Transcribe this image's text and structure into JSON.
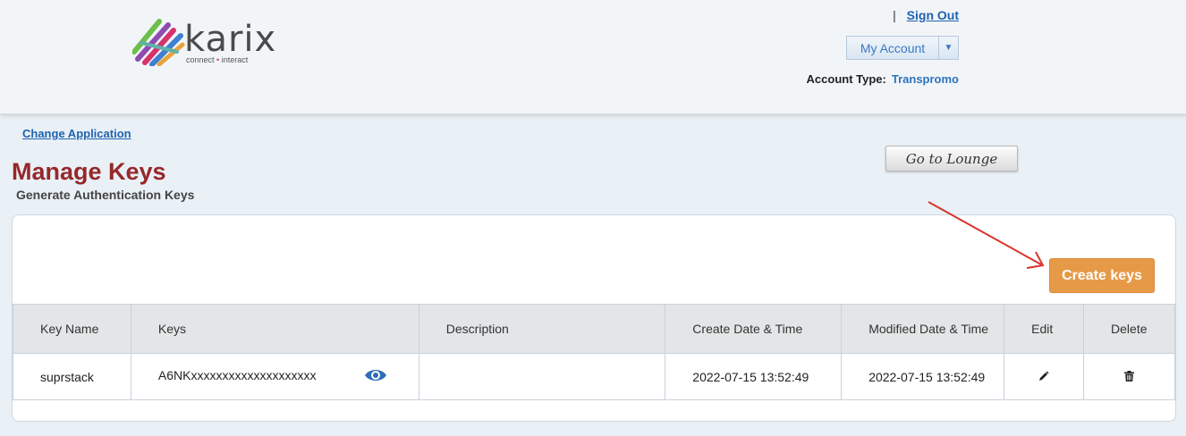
{
  "header": {
    "logo": {
      "brand": "karix",
      "tagline_left": "connect",
      "tagline_right": "interact",
      "tagline_separator": "•"
    },
    "separator": "|",
    "sign_out": "Sign Out",
    "my_account": "My Account",
    "account_type_label": "Account Type:",
    "account_type_value": "Transpromo"
  },
  "nav": {
    "change_application": "Change Application"
  },
  "page": {
    "title": "Manage Keys",
    "subtitle": "Generate Authentication Keys",
    "go_to_lounge": "Go to Lounge",
    "create_keys": "Create keys"
  },
  "table": {
    "headers": [
      "Key Name",
      "Keys",
      "Description",
      "Create Date & Time",
      "Modified Date & Time",
      "Edit",
      "Delete"
    ],
    "rows": [
      {
        "key_name": "suprstack",
        "key": "A6NKxxxxxxxxxxxxxxxxxxxx",
        "description": "",
        "created": "2022-07-15 13:52:49",
        "modified": "2022-07-15 13:52:49"
      }
    ]
  },
  "icons": {
    "view": "eye-icon",
    "edit": "pencil-icon",
    "delete": "trash-icon",
    "dropdown": "chevron-down-icon"
  },
  "colors": {
    "title": "#96282a",
    "link": "#1f62b0",
    "create_button": "#e69a47",
    "annotation_arrow": "#d9342b"
  }
}
